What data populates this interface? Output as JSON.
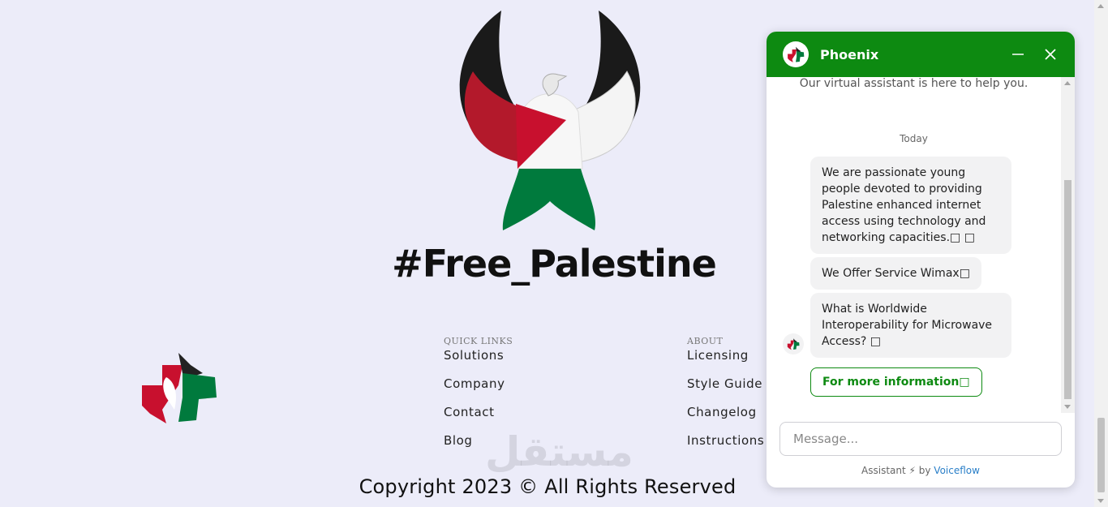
{
  "hero": {
    "title": "#Free_Palestine"
  },
  "footer": {
    "quick_links": {
      "heading": "QUICK LINKS",
      "items": [
        "Solutions",
        "Company",
        "Contact",
        "Blog"
      ]
    },
    "about": {
      "heading": "ABOUT",
      "items": [
        "Licensing",
        "Style Guide",
        "Changelog",
        "Instructions"
      ]
    },
    "watermark": "مستقل",
    "copyright": "Copyright 2023 © All Rights Reserved"
  },
  "chat": {
    "name": "Phoenix",
    "tagline": "Our virtual assistant is here to help you.",
    "day_label": "Today",
    "messages": [
      "We are passionate young people devoted to providing Palestine enhanced internet access using technology and networking capacities.□ □",
      "We Offer Service Wimax□",
      "What is Worldwide Interoperability for Microwave Access? □"
    ],
    "cta_label": "For more information□",
    "input_placeholder": "Message...",
    "powered_prefix": "Assistant ⚡ by ",
    "powered_link": "Voiceflow"
  },
  "colors": {
    "brand_green": "#0d8a11",
    "flag_red": "#c8102e",
    "flag_green": "#007a3d",
    "flag_black": "#111111"
  }
}
